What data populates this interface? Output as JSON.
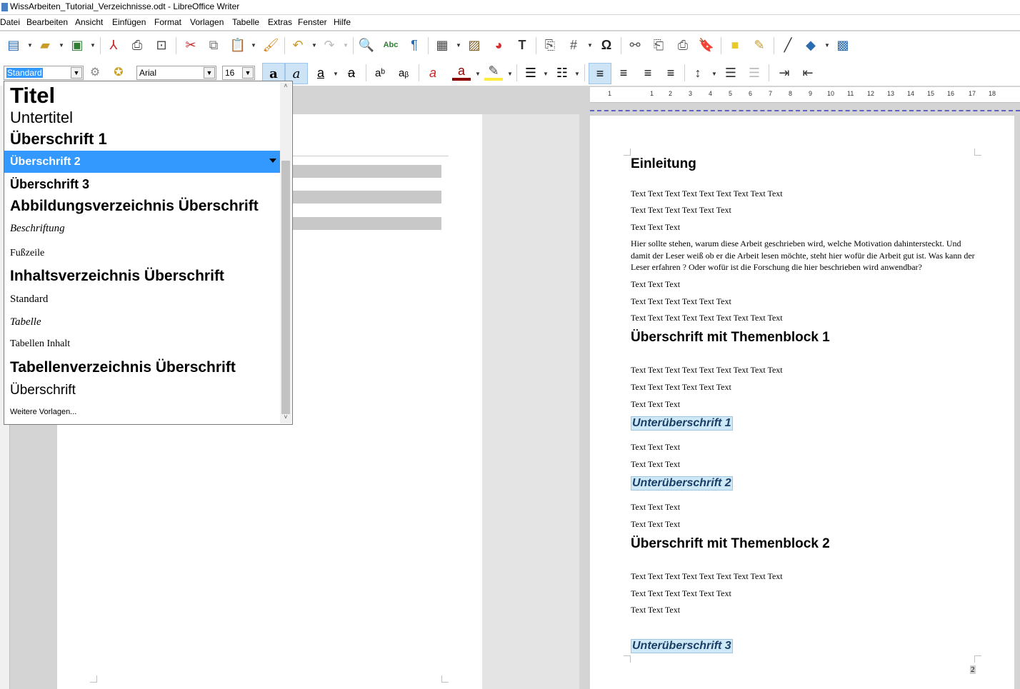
{
  "window": {
    "title": "WissArbeiten_Tutorial_Verzeichnisse.odt - LibreOffice Writer"
  },
  "menu": [
    "Datei",
    "Bearbeiten",
    "Ansicht",
    "Einfügen",
    "Format",
    "Vorlagen",
    "Tabelle",
    "Extras",
    "Fenster",
    "Hilfe"
  ],
  "format_bar": {
    "paragraph_style": "Standard",
    "font_name": "Arial",
    "font_size": "16"
  },
  "ruler": {
    "ticks": [
      "1",
      "1",
      "2",
      "3",
      "4",
      "5",
      "6",
      "7",
      "8",
      "9",
      "10",
      "11",
      "12",
      "13",
      "14",
      "15",
      "16",
      "17",
      "18"
    ]
  },
  "style_popup": {
    "items": [
      {
        "label": "Titel"
      },
      {
        "label": "Untertitel"
      },
      {
        "label": "Überschrift 1"
      },
      {
        "label": "Überschrift 2",
        "selected": true
      },
      {
        "label": "Überschrift 3"
      },
      {
        "label": "Abbildungsverzeichnis Überschrift"
      },
      {
        "label": "Beschriftung"
      },
      {
        "label": "Fußzeile"
      },
      {
        "label": "Inhaltsverzeichnis Überschrift"
      },
      {
        "label": "Standard"
      },
      {
        "label": "Tabelle"
      },
      {
        "label": "Tabellen Inhalt"
      },
      {
        "label": "Tabellenverzeichnis Überschrift"
      },
      {
        "label": "Überschrift"
      },
      {
        "label": "Weitere Vorlagen..."
      }
    ]
  },
  "document": {
    "heading_einleitung": "Einleitung",
    "t1": "Text Text Text Text Text Text Text Text Text",
    "t2": "Text Text Text Text Text Text",
    "t3": "Text Text Text",
    "para_1": "Hier sollte stehen, warum diese Arbeit geschrieben wird, welche Motivation dahintersteckt. Und",
    "para_2": "damit der Leser weiß ob er die Arbeit lesen möchte, steht hier wofür die Arbeit gut ist. Was kann der",
    "para_3": "Leser erfahren ? Oder wofür ist die Forschung die hier beschrieben wird anwendbar?",
    "t4": "Text Text Text",
    "t5": "Text Text Text Text Text Text",
    "t6": "Text Text Text Text Text Text Text Text Text",
    "heading_block1": "Überschrift mit Themenblock 1",
    "t7": "Text Text Text Text Text Text Text Text Text",
    "t8": "Text Text Text Text Text Text",
    "t9": "Text Text Text",
    "sub1": "Unterüberschrift 1",
    "t10": "Text Text Text",
    "t11": "Text Text Text",
    "sub2": "Unterüberschrift 2",
    "t12": "Text Text Text",
    "t13": "Text Text Text",
    "heading_block2": "Überschrift mit Themenblock 2",
    "t14": "Text Text Text Text Text Text Text Text Text",
    "t15": "Text Text Text Text Text Text",
    "t16": "Text Text Text",
    "sub3": "Unterüberschrift 3",
    "page_number": "2"
  },
  "colors": {
    "selection": "#3399ff",
    "subheading_bg": "#cfe8f7",
    "subheading_text": "#1a3f66"
  }
}
